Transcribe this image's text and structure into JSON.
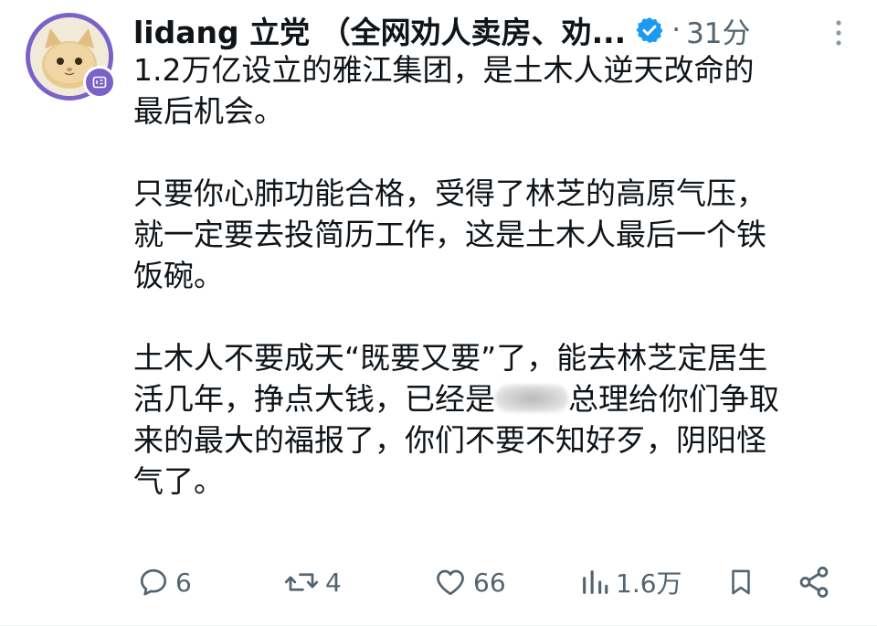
{
  "author": {
    "name": "lidang 立党 （全网劝人卖房、劝...",
    "time_ago": "31分",
    "dot": "·"
  },
  "post": {
    "paragraphs": [
      {
        "lines": [
          "1.2万亿设立的雅江集团，是土木人逆天改命的",
          "最后机会。"
        ]
      },
      {
        "lines": [
          "只要你心肺功能合格，受得了林芝的高原气压，",
          "就一定要去投简历工作，这是土木人最后一个铁",
          "饭碗。"
        ]
      },
      {
        "lines": [
          "土木人不要成天“既要又要”了，能去林芝定居生",
          "活几年，挣点大钱，已经是"
        ],
        "line2_after_blur": "总理给你们争取",
        "more_lines": [
          "来的最大的福报了，你们不要不知好歹，阴阳怪",
          "气了。"
        ]
      }
    ]
  },
  "actions": {
    "replies": "6",
    "reposts": "4",
    "likes": "66",
    "views": "1.6万"
  },
  "icons": {
    "verified": "verified-badge-icon",
    "more": "more-vertical-icon",
    "reply": "reply-icon",
    "repost": "repost-icon",
    "like": "heart-icon",
    "views": "views-chart-icon",
    "bookmark": "bookmark-icon",
    "share": "share-icon"
  },
  "colors": {
    "accent": "#1d9bf0",
    "avatar_ring": "#7a62c9",
    "muted": "#536471",
    "text": "#0f1419"
  }
}
